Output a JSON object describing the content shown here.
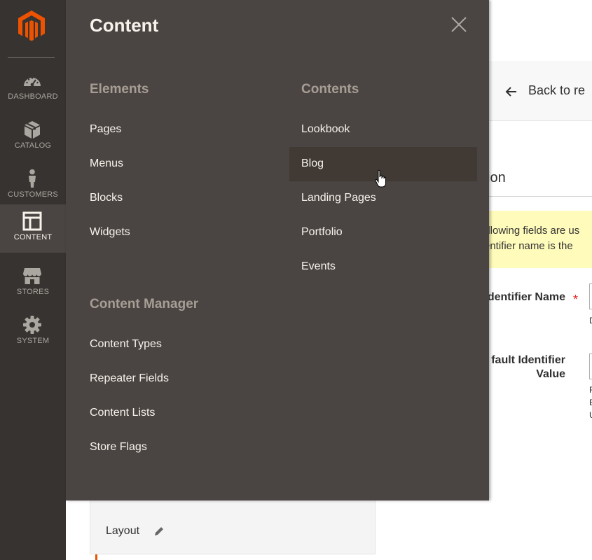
{
  "nav": {
    "items": [
      {
        "label": "DASHBOARD",
        "icon": "dashboard-icon"
      },
      {
        "label": "CATALOG",
        "icon": "catalog-box-icon"
      },
      {
        "label": "CUSTOMERS",
        "icon": "customer-person-icon"
      },
      {
        "label": "CONTENT",
        "icon": "content-layout-icon"
      },
      {
        "label": "STORES",
        "icon": "stores-shop-icon"
      },
      {
        "label": "SYSTEM",
        "icon": "gear-icon"
      }
    ],
    "active": "CONTENT",
    "accent_color": "#eb5202"
  },
  "panel": {
    "title": "Content",
    "groups": [
      {
        "title": "Elements",
        "links": [
          "Pages",
          "Menus",
          "Blocks",
          "Widgets"
        ]
      },
      {
        "title": "Content Manager",
        "links": [
          "Content Types",
          "Repeater Fields",
          "Content Lists",
          "Store Flags"
        ]
      },
      {
        "title": "Contents",
        "links": [
          "Lookbook",
          "Blog",
          "Landing Pages",
          "Portfolio",
          "Events"
        ]
      }
    ],
    "hovered": "Blog"
  },
  "page": {
    "back_label": "Back to re",
    "section_title": "rmation",
    "notice_lines": [
      "ollowing fields are us",
      "entifier name is the"
    ],
    "fields": [
      {
        "label": "dentifier Name",
        "required": true,
        "hint": "D"
      },
      {
        "label_line1": "fault Identifier",
        "label_line2": "Value",
        "hints": [
          "F",
          "E",
          "U"
        ]
      }
    ],
    "layout_label": "Layout"
  }
}
